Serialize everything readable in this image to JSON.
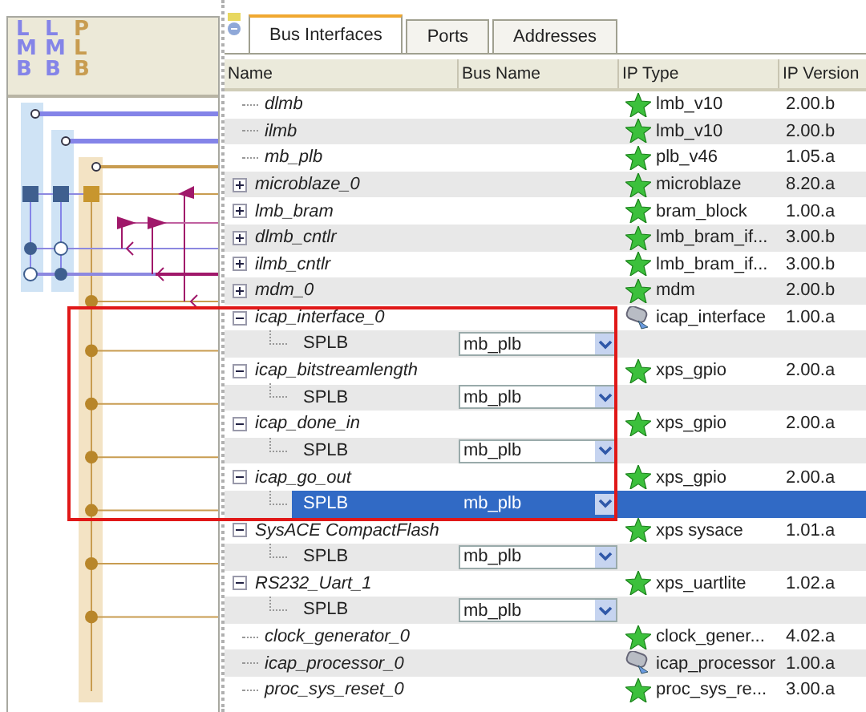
{
  "bus_panel": {
    "buses": [
      {
        "label": "LMB",
        "color": "#8484e8"
      },
      {
        "label": "LMB",
        "color": "#8484e8"
      },
      {
        "label": "PLB",
        "color": "#c89c50"
      }
    ]
  },
  "tabs": [
    {
      "label": "Bus Interfaces",
      "selected": true
    },
    {
      "label": "Ports",
      "selected": false
    },
    {
      "label": "Addresses",
      "selected": false
    }
  ],
  "table": {
    "columns": [
      "Name",
      "Bus Name",
      "IP Type",
      "IP Version"
    ],
    "rows": [
      {
        "name": "dlmb",
        "kind": "leaf",
        "selected": false,
        "ip": {
          "kind": "standard",
          "type": "lmb_v10",
          "version": "2.00.b"
        }
      },
      {
        "name": "ilmb",
        "kind": "leaf",
        "selected": false,
        "ip": {
          "kind": "standard",
          "type": "lmb_v10",
          "version": "2.00.b"
        }
      },
      {
        "name": "mb_plb",
        "kind": "leaf",
        "selected": false,
        "ip": {
          "kind": "standard",
          "type": "plb_v46",
          "version": "1.05.a"
        }
      },
      {
        "name": "microblaze_0",
        "kind": "group",
        "expanded": false,
        "selected": false,
        "ip": {
          "kind": "standard",
          "type": "microblaze",
          "version": "8.20.a"
        }
      },
      {
        "name": "lmb_bram",
        "kind": "group",
        "expanded": false,
        "selected": false,
        "ip": {
          "kind": "standard",
          "type": "bram_block",
          "version": "1.00.a"
        }
      },
      {
        "name": "dlmb_cntlr",
        "kind": "group",
        "expanded": false,
        "selected": false,
        "ip": {
          "kind": "standard",
          "type": "lmb_bram_if...",
          "version": "3.00.b"
        }
      },
      {
        "name": "ilmb_cntlr",
        "kind": "group",
        "expanded": false,
        "selected": false,
        "ip": {
          "kind": "standard",
          "type": "lmb_bram_if...",
          "version": "3.00.b"
        }
      },
      {
        "name": "mdm_0",
        "kind": "group",
        "expanded": false,
        "selected": false,
        "ip": {
          "kind": "standard",
          "type": "mdm",
          "version": "2.00.b"
        }
      },
      {
        "name": "icap_interface_0",
        "kind": "group",
        "expanded": true,
        "selected": false,
        "ip": {
          "kind": "custom",
          "type": "icap_interface",
          "version": "1.00.a"
        },
        "children": [
          {
            "name": "SPLB",
            "bus_name": "mb_plb",
            "selected": false
          }
        ]
      },
      {
        "name": "icap_bitstreamlength",
        "kind": "group",
        "expanded": true,
        "selected": false,
        "ip": {
          "kind": "standard",
          "type": "xps_gpio",
          "version": "2.00.a"
        },
        "children": [
          {
            "name": "SPLB",
            "bus_name": "mb_plb",
            "selected": false
          }
        ]
      },
      {
        "name": "icap_done_in",
        "kind": "group",
        "expanded": true,
        "selected": false,
        "ip": {
          "kind": "standard",
          "type": "xps_gpio",
          "version": "2.00.a"
        },
        "children": [
          {
            "name": "SPLB",
            "bus_name": "mb_plb",
            "selected": false
          }
        ]
      },
      {
        "name": "icap_go_out",
        "kind": "group",
        "expanded": true,
        "selected": false,
        "ip": {
          "kind": "standard",
          "type": "xps_gpio",
          "version": "2.00.a"
        },
        "children": [
          {
            "name": "SPLB",
            "bus_name": "mb_plb",
            "selected": true
          }
        ]
      },
      {
        "name": "SysACE CompactFlash",
        "kind": "group",
        "expanded": true,
        "selected": false,
        "ip": {
          "kind": "standard",
          "type": "xps sysace",
          "version": "1.01.a"
        },
        "children": [
          {
            "name": "SPLB",
            "bus_name": "mb_plb",
            "selected": false
          }
        ]
      },
      {
        "name": "RS232_Uart_1",
        "kind": "group",
        "expanded": true,
        "selected": false,
        "ip": {
          "kind": "standard",
          "type": "xps_uartlite",
          "version": "1.02.a"
        },
        "children": [
          {
            "name": "SPLB",
            "bus_name": "mb_plb",
            "selected": false
          }
        ]
      },
      {
        "name": "clock_generator_0",
        "kind": "leaf",
        "selected": false,
        "ip": {
          "kind": "standard",
          "type": "clock_gener...",
          "version": "4.02.a"
        }
      },
      {
        "name": "icap_processor_0",
        "kind": "leaf",
        "selected": false,
        "ip": {
          "kind": "custom",
          "type": "icap_processor",
          "version": "1.00.a"
        }
      },
      {
        "name": "proc_sys_reset_0",
        "kind": "leaf",
        "selected": false,
        "ip": {
          "kind": "standard",
          "type": "proc_sys_re...",
          "version": "3.00.a"
        }
      }
    ]
  }
}
